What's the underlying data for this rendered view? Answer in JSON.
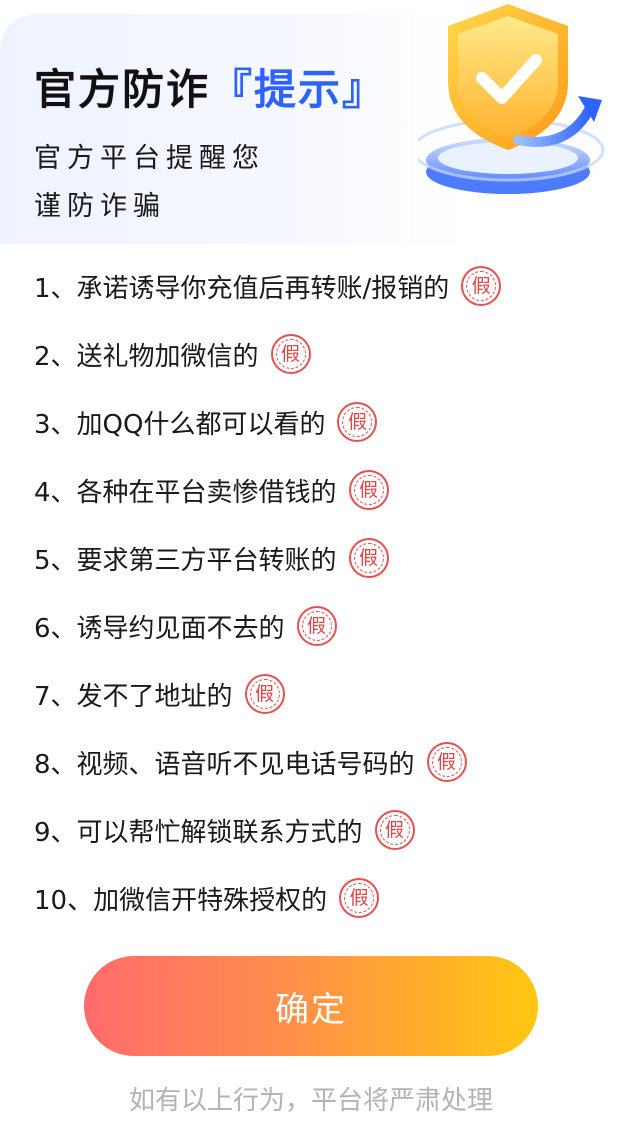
{
  "header": {
    "title_main": "官方防诈",
    "bracket_left": "『",
    "title_highlight": "提示",
    "bracket_right": "』",
    "subtitle_line1": "官方平台提醒您",
    "subtitle_line2": "谨防诈骗"
  },
  "stamp_label": "假",
  "items": [
    {
      "text": "1、承诺诱导你充值后再转账/报销的"
    },
    {
      "text": "2、送礼物加微信的"
    },
    {
      "text": "3、加QQ什么都可以看的"
    },
    {
      "text": "4、各种在平台卖惨借钱的"
    },
    {
      "text": "5、要求第三方平台转账的"
    },
    {
      "text": "6、诱导约见面不去的"
    },
    {
      "text": "7、发不了地址的"
    },
    {
      "text": "8、视频、语音听不见电话号码的"
    },
    {
      "text": "9、可以帮忙解锁联系方式的"
    },
    {
      "text": "10、加微信开特殊授权的"
    }
  ],
  "confirm_label": "确定",
  "footer_note": "如有以上行为，平台将严肃处理",
  "colors": {
    "accent_blue": "#2e62ff",
    "stamp_red": "#e04545",
    "button_gradient_start": "#ff6b6b",
    "button_gradient_end": "#ffc712"
  },
  "icons": {
    "shield": "shield-check-icon",
    "stamp": "fake-stamp-icon"
  }
}
